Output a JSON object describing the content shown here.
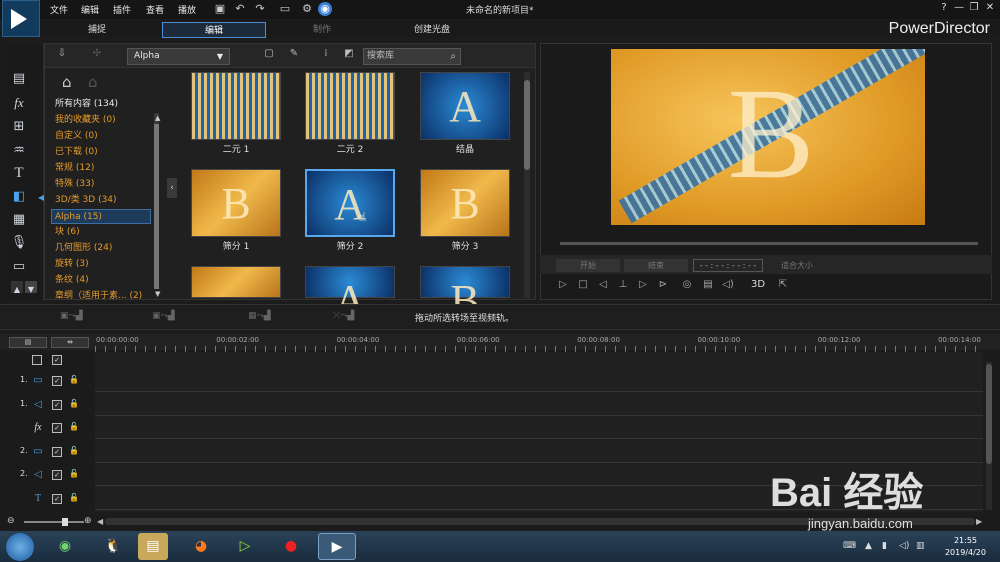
{
  "menu": {
    "items": [
      "文件",
      "编辑",
      "插件",
      "查看",
      "播放"
    ],
    "title": "未命名的新项目*",
    "window_buttons": [
      "?",
      "—",
      "❐",
      "✕"
    ]
  },
  "modes": {
    "tabs": [
      "捕捉",
      "编辑",
      "制作",
      "创建光盘"
    ],
    "active": "编辑",
    "brand": "PowerDirector"
  },
  "left_toolbar": {
    "icons": [
      "media-room-icon",
      "fx-icon",
      "pip-icon",
      "particle-icon",
      "title-icon",
      "transition-icon",
      "audio-mixer-icon",
      "voice-icon",
      "subtitle-icon"
    ],
    "fx_label": "fx",
    "title_label": "T"
  },
  "library": {
    "filter": "Alpha",
    "search_placeholder": "搜索库",
    "categories": [
      {
        "label": "所有内容 (134)",
        "style": "white"
      },
      {
        "label": "我的收藏夹  (0)",
        "style": "gold"
      },
      {
        "label": "自定义  (0)",
        "style": "gold"
      },
      {
        "label": "已下载  (0)",
        "style": "gold"
      },
      {
        "label": "常规  (12)",
        "style": "gold"
      },
      {
        "label": "特殊  (33)",
        "style": "gold"
      },
      {
        "label": "3D/类 3D  (34)",
        "style": "gold"
      },
      {
        "label": "Alpha  (15)",
        "style": "selected"
      },
      {
        "label": "块  (6)",
        "style": "gold"
      },
      {
        "label": "几何图形  (24)",
        "style": "gold"
      },
      {
        "label": "旋转  (3)",
        "style": "gold"
      },
      {
        "label": "条纹  (4)",
        "style": "gold"
      },
      {
        "label": "章纲（适用于素...  (2)",
        "style": "gold"
      }
    ],
    "thumbnails": [
      {
        "label": "二元 1",
        "letter": ""
      },
      {
        "label": "二元 2",
        "letter": ""
      },
      {
        "label": "结晶",
        "letter": "A"
      },
      {
        "label": "筛分 1",
        "letter": "B"
      },
      {
        "label": "筛分 2",
        "letter": "A"
      },
      {
        "label": "筛分 3",
        "letter": "B"
      },
      {
        "label": "",
        "letter": ""
      },
      {
        "label": "",
        "letter": "A"
      },
      {
        "label": "",
        "letter": "B"
      }
    ]
  },
  "preview": {
    "letter": "B",
    "start_btn": "开始",
    "end_btn": "结束",
    "timecode": "- - : - - : - - : - -",
    "fit": "适合大小",
    "mode_3d": "3D"
  },
  "middle": {
    "hint": "拖动所选转场至视频轨。"
  },
  "timeline": {
    "timecodes": [
      "00:00:00:00",
      "00:00:02:00",
      "00:00:04:00",
      "00:00:06:00",
      "00:00:08:00",
      "00:00:10:00",
      "00:00:12:00",
      "00:00:14:00"
    ],
    "tracks": [
      {
        "num": "1.",
        "icon": "video-track-icon",
        "glyph": "▭"
      },
      {
        "num": "1.",
        "icon": "audio-track-icon",
        "glyph": "◁"
      },
      {
        "num": "",
        "icon": "fx-track-icon",
        "glyph": "fx"
      },
      {
        "num": "2.",
        "icon": "video-track-icon",
        "glyph": "▭"
      },
      {
        "num": "2.",
        "icon": "audio-track-icon",
        "glyph": "◁"
      },
      {
        "num": "",
        "icon": "title-track-icon",
        "glyph": "T"
      }
    ]
  },
  "taskbar": {
    "time": "21:55",
    "date": "2019/4/20"
  },
  "watermark": {
    "text": "Bai  经验",
    "sub": "jingyan.baidu.com"
  }
}
